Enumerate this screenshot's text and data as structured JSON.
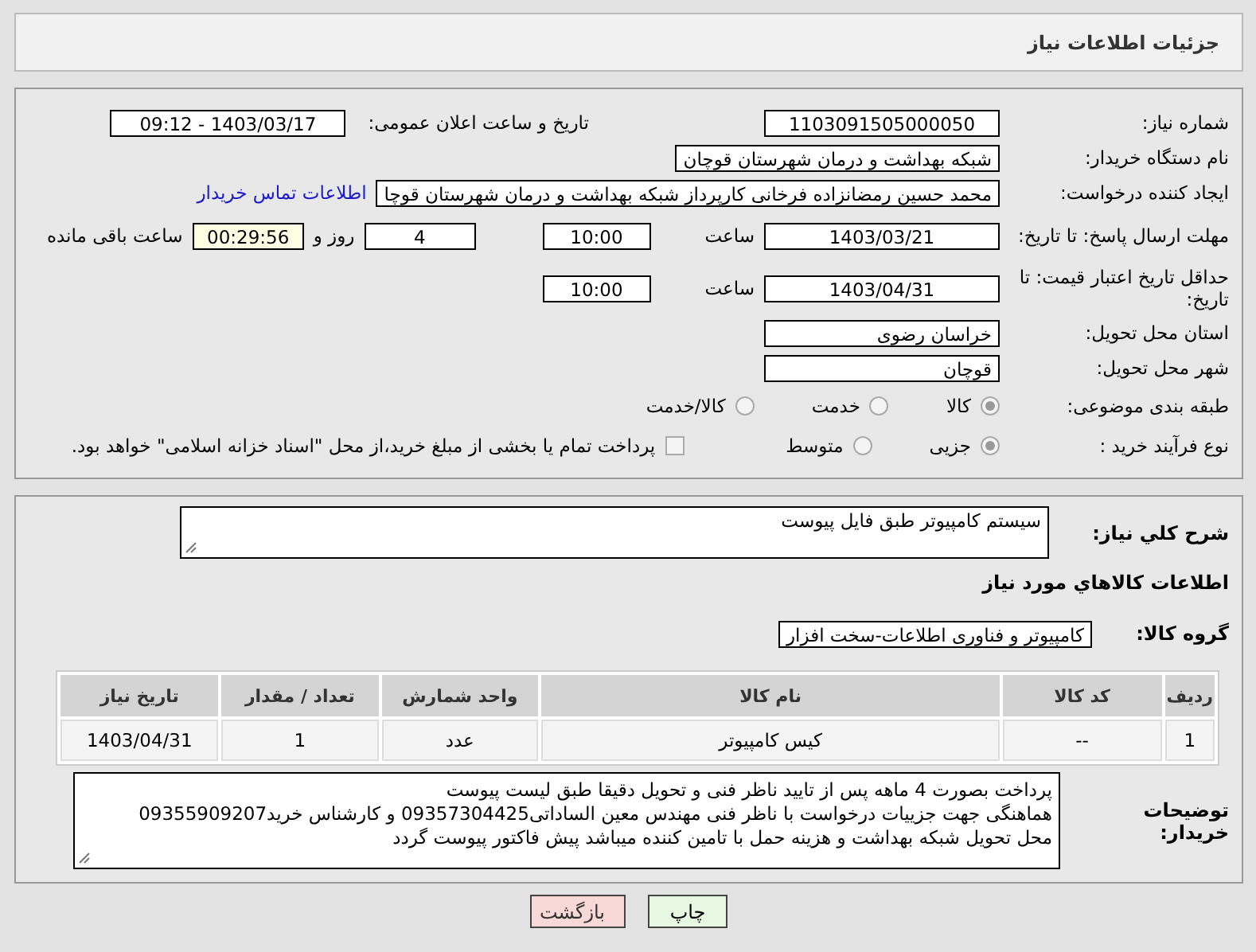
{
  "header": {
    "title": "جزئیات اطلاعات نیاز"
  },
  "details": {
    "need_number": {
      "label": "شماره نیاز:",
      "value": "1103091505000050"
    },
    "announce": {
      "label": "تاریخ و ساعت اعلان عمومی:",
      "value": "1403/03/17 - 09:12"
    },
    "buyer_org": {
      "label": "نام دستگاه خریدار:",
      "value": "شبکه بهداشت و درمان شهرستان قوچان"
    },
    "creator": {
      "label": "ایجاد کننده درخواست:",
      "value": "محمد حسین رمضانزاده فرخانی کارپرداز شبکه بهداشت و درمان شهرستان قوچا",
      "link": "اطلاعات تماس خریدار"
    },
    "deadline": {
      "label": "مهلت ارسال پاسخ: تا تاریخ:",
      "date": "1403/03/21",
      "time_label": "ساعت",
      "time": "10:00",
      "days": "4",
      "days_label": "روز و",
      "remaining": "00:29:56",
      "remaining_label": "ساعت باقی مانده"
    },
    "validity": {
      "label": "حداقل تاریخ اعتبار قیمت: تا تاریخ:",
      "date": "1403/04/31",
      "time_label": "ساعت",
      "time": "10:00"
    },
    "province": {
      "label": "استان محل تحویل:",
      "value": "خراسان رضوی"
    },
    "city": {
      "label": "شهر محل تحویل:",
      "value": "قوچان"
    },
    "category": {
      "label": "طبقه بندی موضوعی:",
      "options": [
        {
          "label": "کالا",
          "selected": true
        },
        {
          "label": "خدمت",
          "selected": false
        },
        {
          "label": "کالا/خدمت",
          "selected": false
        }
      ]
    },
    "process": {
      "label": "نوع فرآیند خرید :",
      "options": [
        {
          "label": "جزیی",
          "selected": true
        },
        {
          "label": "متوسط",
          "selected": false
        }
      ],
      "payment": {
        "checked": false,
        "text": "پرداخت تمام یا بخشی از مبلغ خرید،از محل \"اسناد خزانه اسلامی\" خواهد بود."
      }
    }
  },
  "need": {
    "description_label": "شرح کلي نياز:",
    "description": "سیستم کامپیوتر طبق فایل پیوست",
    "goods_heading": "اطلاعات کالاهاي مورد نياز",
    "group_label": "گروه کالا:",
    "group": "کامپیوتر و فناوری اطلاعات-سخت افزار",
    "table": {
      "columns": [
        "ردیف",
        "کد کالا",
        "نام کالا",
        "واحد شمارش",
        "تعداد / مقدار",
        "تاریخ نیاز"
      ],
      "rows": [
        [
          "1",
          "--",
          "کیس کامپیوتر",
          "عدد",
          "1",
          "1403/04/31"
        ]
      ]
    },
    "notes_label": "توضیحات خریدار:",
    "notes": "پرداخت بصورت 4 ماهه پس از تایید ناظر فنی و تحویل دقیقا طبق لیست پیوست\nهماهنگی جهت جزییات درخواست با ناظر فنی  مهندس معین الساداتی09357304425 و کارشناس خرید09355909207\nمحل تحویل شبکه بهداشت و هزینه حمل با تامین کننده میباشد پیش فاکتور پیوست گردد"
  },
  "buttons": [
    {
      "label": "چاپ",
      "kind": "print"
    },
    {
      "label": "بازگشت",
      "kind": "back"
    }
  ]
}
